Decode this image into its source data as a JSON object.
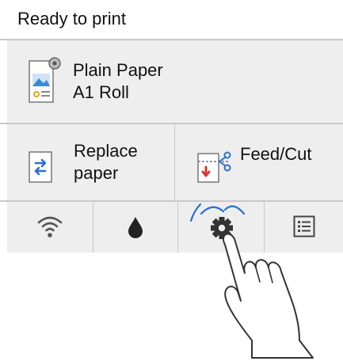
{
  "status": {
    "title": "Ready to print"
  },
  "paper": {
    "type": "Plain Paper",
    "size": "A1 Roll",
    "icon": "roll-paper-icon"
  },
  "actions": {
    "replace": {
      "line1": "Replace",
      "line2": "paper",
      "icon": "replace-paper-icon"
    },
    "feed": {
      "label": "Feed/Cut",
      "icon": "feed-cut-icon"
    }
  },
  "toolbar": [
    {
      "icon": "wifi-icon"
    },
    {
      "icon": "ink-drop-icon"
    },
    {
      "icon": "gear-icon"
    },
    {
      "icon": "list-menu-icon"
    }
  ],
  "colors": {
    "panel": "#eeeeee",
    "divider": "#c8c8c8",
    "accent_blue": "#2a6fd1",
    "accent_red": "#d9362b",
    "icon_dark": "#333333"
  }
}
